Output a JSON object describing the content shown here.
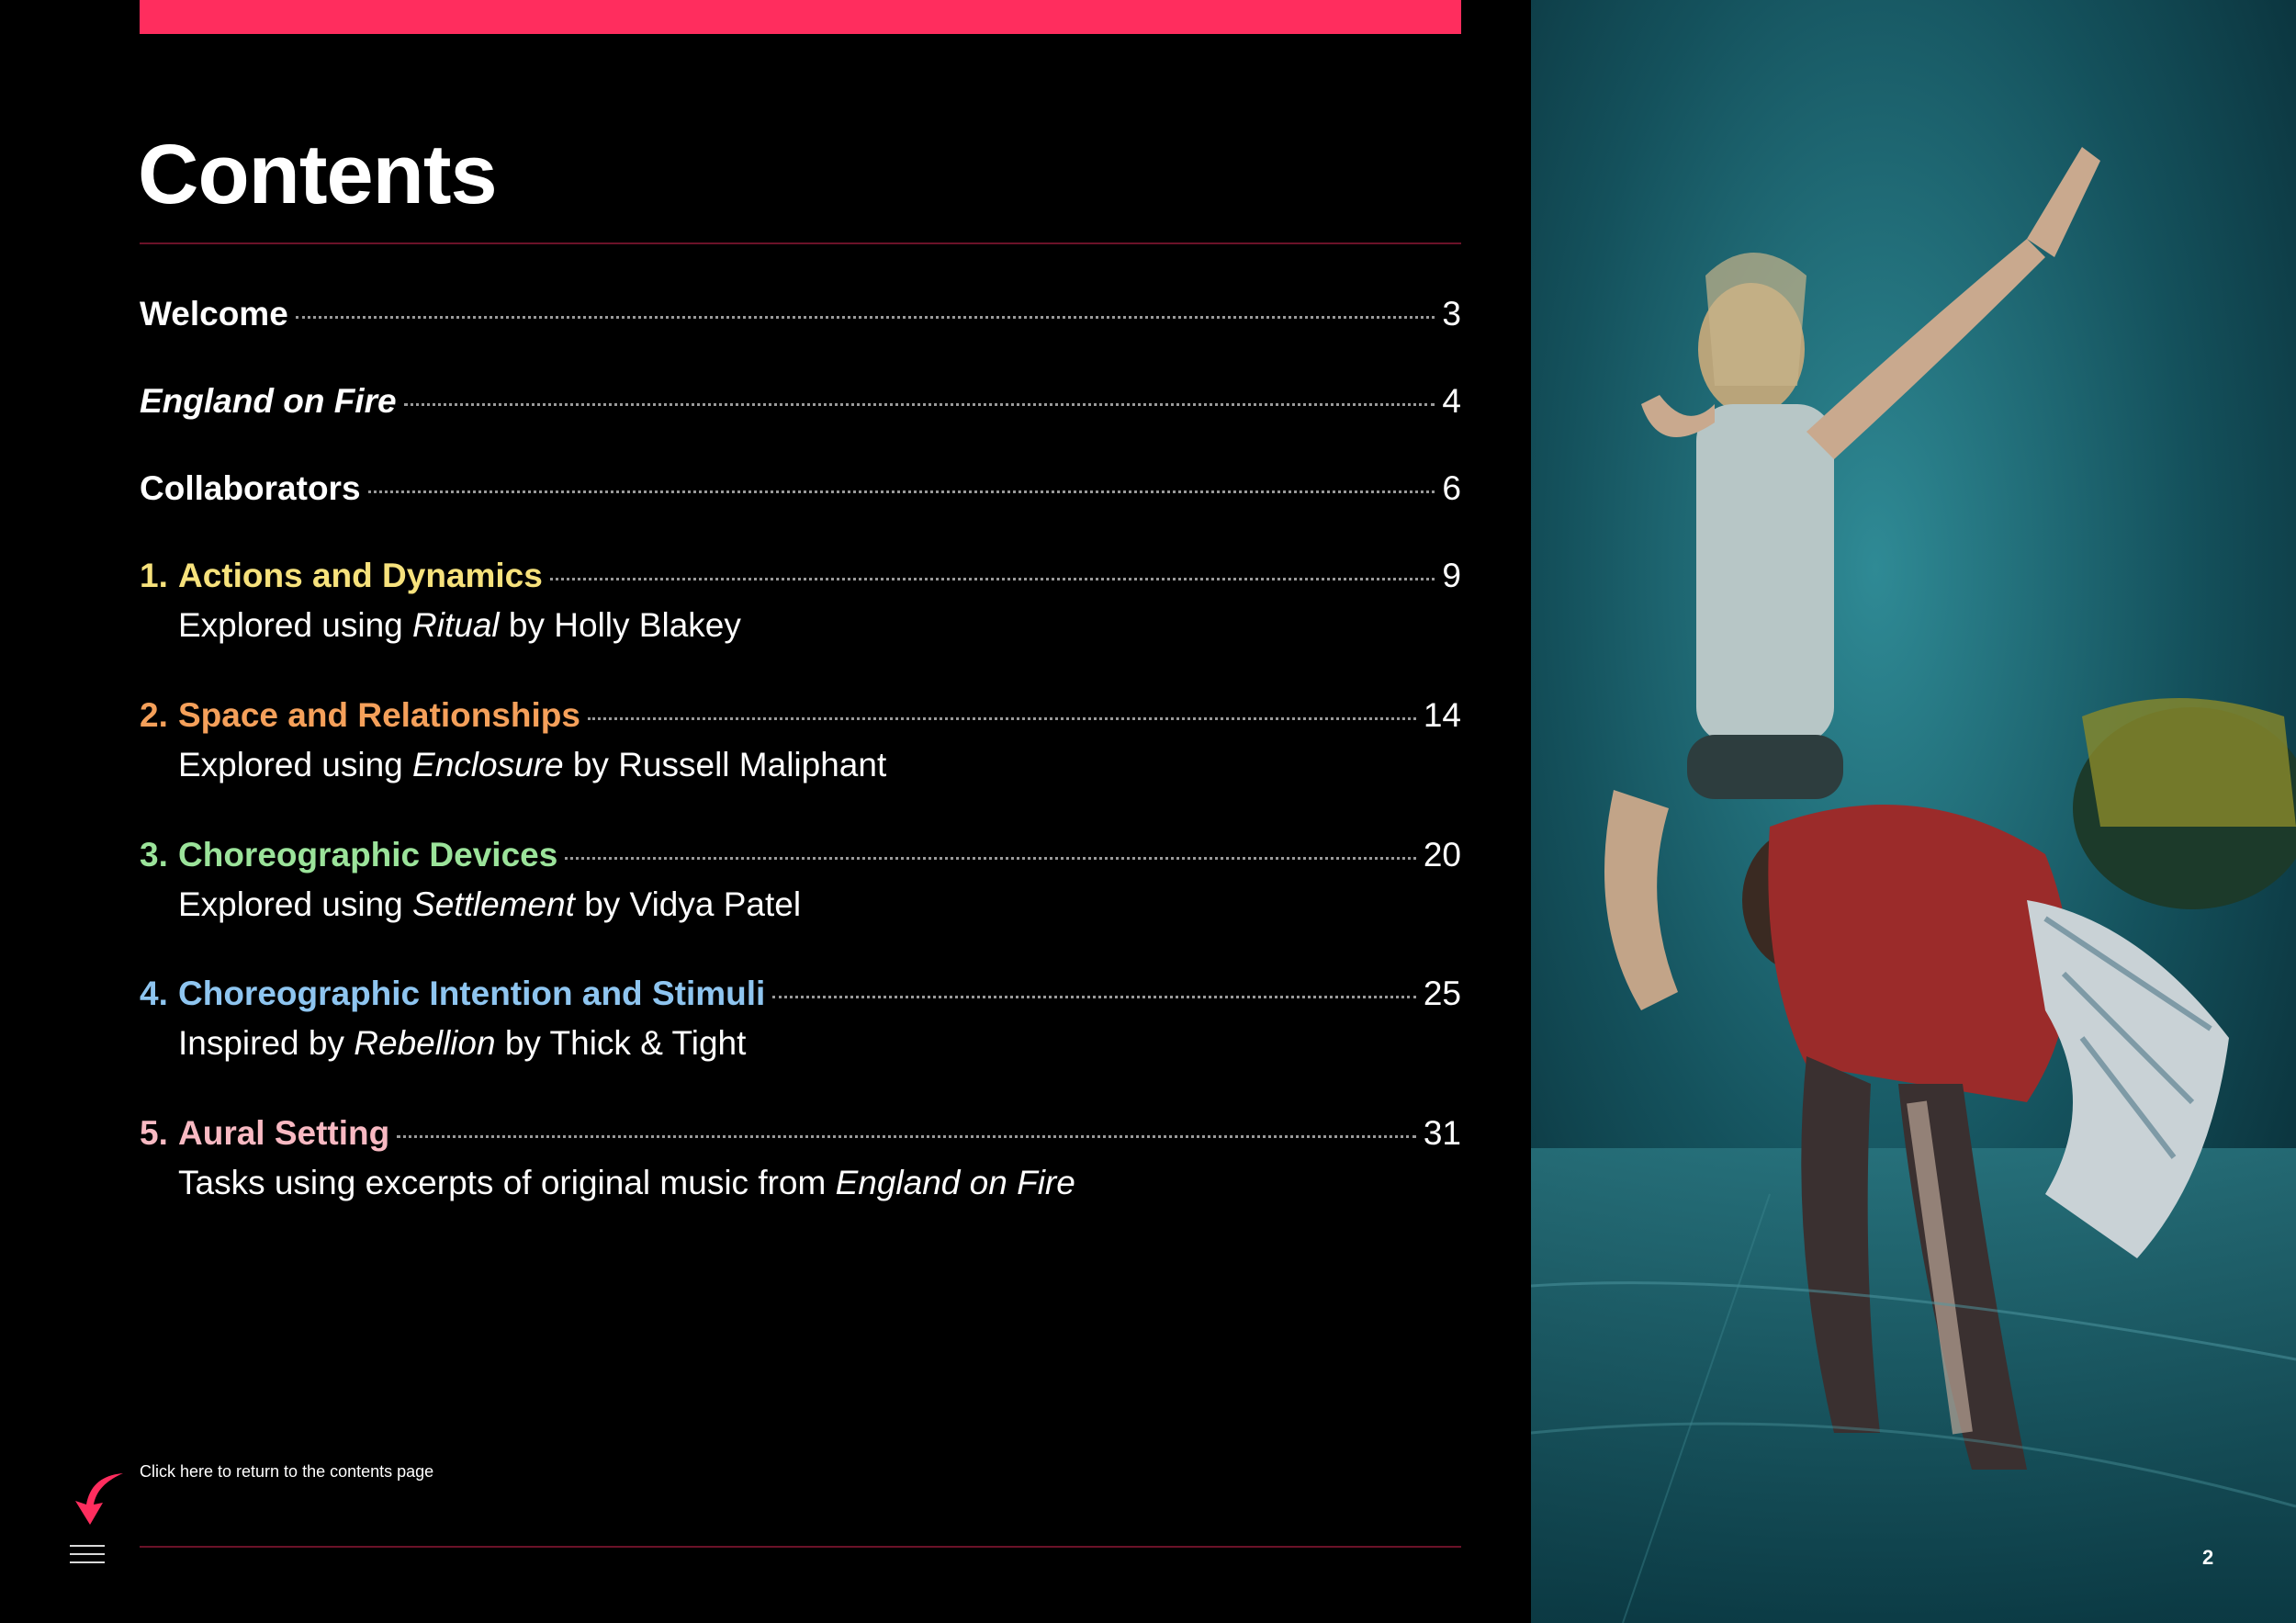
{
  "header": {
    "title": "Contents"
  },
  "toc": {
    "welcome": {
      "label": "Welcome",
      "page": "3"
    },
    "england": {
      "label": "England on Fire",
      "page": "4"
    },
    "collaborators": {
      "label": "Collaborators",
      "page": "6"
    },
    "sections": [
      {
        "num": "1.",
        "label": "Actions and Dynamics",
        "page": "9",
        "sub_prefix": "Explored using ",
        "sub_italic": "Ritual",
        "sub_suffix": " by Holly Blakey",
        "color": "#f7e27c"
      },
      {
        "num": "2.",
        "label": "Space and Relationships",
        "page": "14",
        "sub_prefix": "Explored using ",
        "sub_italic": "Enclosure",
        "sub_suffix": " by Russell Maliphant",
        "color": "#f5a05a"
      },
      {
        "num": "3.",
        "label": "Choreographic Devices",
        "page": "20",
        "sub_prefix": "Explored using ",
        "sub_italic": "Settlement",
        "sub_suffix": " by Vidya Patel",
        "color": "#9be39a"
      },
      {
        "num": "4.",
        "label": "Choreographic Intention and Stimuli",
        "page": "25",
        "sub_prefix": "Inspired by ",
        "sub_italic": "Rebellion",
        "sub_suffix": " by Thick & Tight",
        "color": "#8ec5f0"
      },
      {
        "num": "5.",
        "label": "Aural Setting",
        "page": "31",
        "sub_prefix": "Tasks using excerpts of original music from ",
        "sub_italic": "England on Fire",
        "sub_suffix": "",
        "color": "#f8b9c2"
      }
    ]
  },
  "footer": {
    "return_note": "Click here to return to the contents page",
    "page_number": "2"
  },
  "icons": {
    "return": "curved-arrow-icon",
    "menu": "hamburger-menu-icon"
  },
  "colors": {
    "accent": "#ff2d5e",
    "rule": "#6b1228",
    "background": "#000000"
  }
}
